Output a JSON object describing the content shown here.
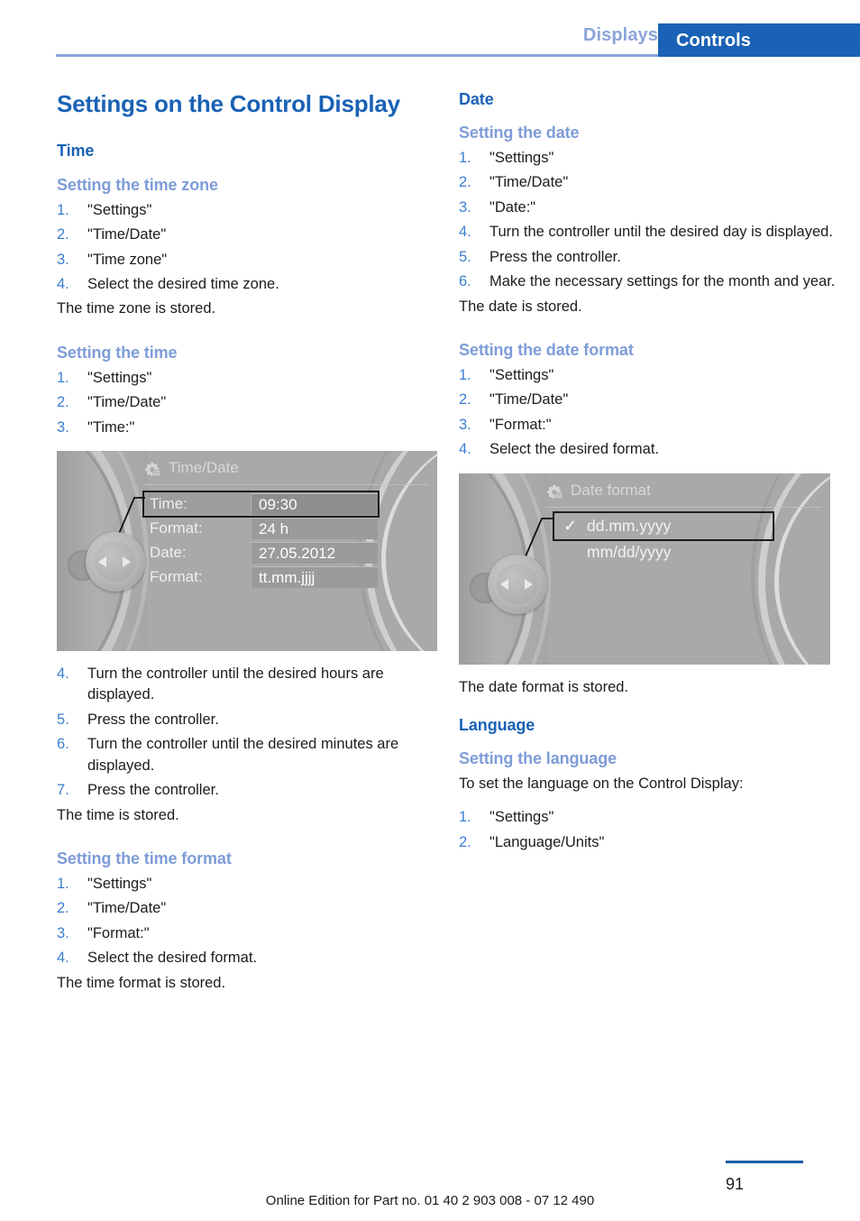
{
  "header": {
    "tab_inactive": "Displays",
    "tab_active": "Controls",
    "accent_blue": "#1a62b5",
    "muted_blue": "#8ba4da"
  },
  "left_column": {
    "chapter_title": "Settings on the Control Display",
    "time_section": "Time",
    "time_zone": {
      "heading": "Setting the time zone",
      "steps": [
        "\"Settings\"",
        "\"Time/Date\"",
        "\"Time zone\"",
        "Select the desired time zone."
      ],
      "result": "The time zone is stored."
    },
    "setting_time": {
      "heading": "Setting the time",
      "steps_before": [
        "\"Settings\"",
        "\"Time/Date\"",
        "\"Time:\""
      ],
      "steps_after": [
        "Turn the controller until the desired hours are displayed.",
        "Press the controller.",
        "Turn the controller until the desired minutes are displayed.",
        "Press the controller."
      ],
      "result": "The time is stored."
    },
    "time_format": {
      "heading": "Setting the time format",
      "steps": [
        "\"Settings\"",
        "\"Time/Date\"",
        "\"Format:\"",
        "Select the desired format."
      ],
      "result": "The time format is stored."
    }
  },
  "right_column": {
    "date_section": "Date",
    "setting_date": {
      "heading": "Setting the date",
      "steps": [
        "\"Settings\"",
        "\"Time/Date\"",
        "\"Date:\"",
        "Turn the controller until the desired day is displayed.",
        "Press the controller.",
        "Make the necessary settings for the month and year."
      ],
      "result": "The date is stored."
    },
    "date_format": {
      "heading": "Setting the date format",
      "steps": [
        "\"Settings\"",
        "\"Time/Date\"",
        "\"Format:\"",
        "Select the desired format."
      ],
      "result": "The date format is stored."
    },
    "language_section": "Language",
    "setting_language": {
      "heading": "Setting the language",
      "lead": "To set the language on the Control Display:",
      "steps": [
        "\"Settings\"",
        "\"Language/Units\""
      ]
    }
  },
  "figure_time_date": {
    "screen_title": "Time/Date",
    "icon": "gear-icon",
    "rows": [
      {
        "label": "Time:",
        "value": "09:30",
        "selected": true
      },
      {
        "label": "Format:",
        "value": "24 h",
        "selected": false
      },
      {
        "label": "Date:",
        "value": "27.05.2012",
        "selected": false
      },
      {
        "label": "Format:",
        "value": "tt.mm.jjjj",
        "selected": false
      }
    ]
  },
  "figure_date_format": {
    "screen_title": "Date format",
    "icon": "gear-icon",
    "options": [
      {
        "label": "dd.mm.yyyy",
        "checked": true,
        "check": "✓",
        "selected": true
      },
      {
        "label": "mm/dd/yyyy",
        "checked": false,
        "check": "",
        "selected": false
      }
    ]
  },
  "footer": {
    "edition_text": "Online Edition for Part no. 01 40 2 903 008 - 07 12 490",
    "page_number": "91"
  }
}
